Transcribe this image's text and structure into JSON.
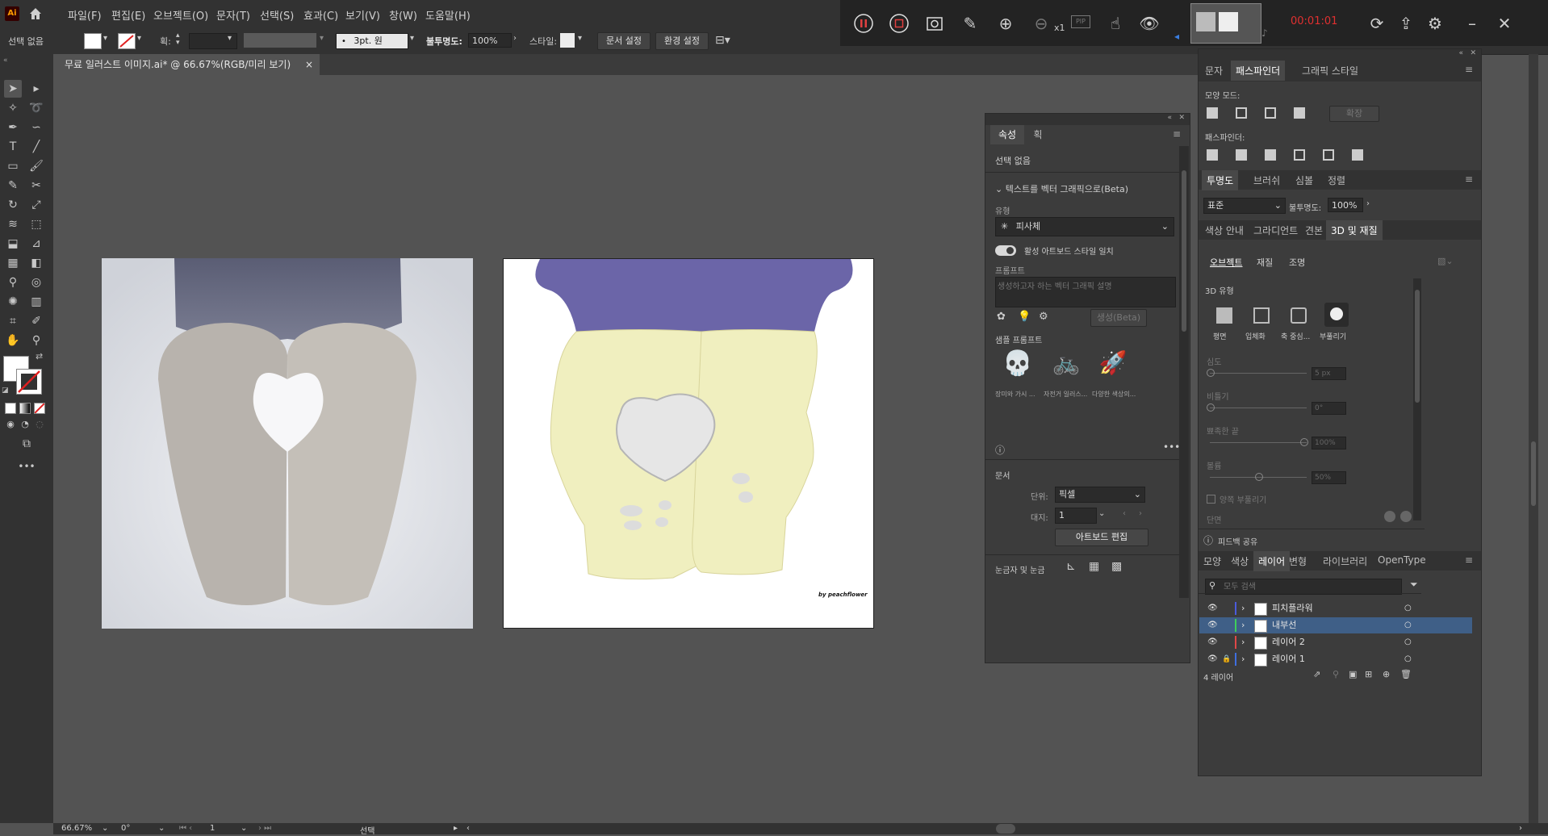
{
  "app": {
    "logo": "Ai"
  },
  "menu": [
    "파일(F)",
    "편집(E)",
    "오브젝트(O)",
    "문자(T)",
    "선택(S)",
    "효과(C)",
    "보기(V)",
    "창(W)",
    "도움말(H)"
  ],
  "control_bar": {
    "selection": "선택 없음",
    "stroke_label": "획:",
    "brush": "3pt. 원",
    "opacity_label": "불투명도:",
    "opacity_value": "100%",
    "style_label": "스타일:",
    "doc_setup": "문서 설정",
    "preferences": "환경 설정"
  },
  "recorder": {
    "speed": "x1",
    "pip": "PIP",
    "timer": "00:01:01"
  },
  "document_tab": {
    "title": "무료 일러스트 이미지.ai* @ 66.67%(RGB/미리 보기)",
    "close": "×"
  },
  "status_bar": {
    "zoom": "66.67%",
    "rotation": "0°",
    "artboard": "1",
    "tool": "선택"
  },
  "properties_panel": {
    "tabs": [
      "속성",
      "획"
    ],
    "no_selection": "선택 없음",
    "text_to_vector": "텍스트를 벡터 그래픽으로(Beta)",
    "type_label": "유형",
    "type_value": "피사체",
    "toggle_label": "활성 아트보드 스타일 일치",
    "prompt_label": "프롬프트",
    "prompt_placeholder": "생성하고자 하는 벡터 그래픽 설명",
    "generate": "생성(Beta)",
    "sample_label": "샘플 프롬프트",
    "samples": [
      "장미와 가시 ...",
      "자전거 일러스...",
      "다양한 색상의..."
    ],
    "document_label": "문서",
    "units_label": "단위:",
    "units_value": "픽셀",
    "artboard_label": "대지:",
    "artboard_value": "1",
    "edit_artboards": "아트보드 편집",
    "rulers_label": "눈금자 및 눈금"
  },
  "pathfinder_panel": {
    "tabs": [
      "문자",
      "패스파인더",
      "그래픽 스타일"
    ],
    "shape_modes": "모양 모드:",
    "expand": "확장",
    "pathfinders": "패스파인더:"
  },
  "transparency_panel": {
    "tabs": [
      "투명도",
      "브러쉬",
      "심볼",
      "정렬"
    ],
    "blend": "표준",
    "opacity_label": "불투명도:",
    "opacity_value": "100%"
  },
  "materials_panel": {
    "tabs": [
      "색상 안내",
      "그라디언트",
      "견본",
      "3D 및 재질"
    ],
    "subtabs": [
      "오브젝트",
      "재질",
      "조명"
    ],
    "type_label": "3D 유형",
    "types": [
      "평면",
      "입체화",
      "축 중심...",
      "부풀리기"
    ],
    "params": [
      {
        "label": "심도",
        "value": "5 px"
      },
      {
        "label": "비틀기",
        "value": "0°"
      },
      {
        "label": "뾰족한 끝",
        "value": "100%"
      },
      {
        "label": "볼륨",
        "value": "50%"
      }
    ],
    "both_sides": "양쪽 부풀리기",
    "bevel": "단면",
    "feedback": "피드백 공유"
  },
  "layers_panel": {
    "tabs": [
      "모양",
      "색상",
      "레이어",
      "변형",
      "라이브러리",
      "OpenType"
    ],
    "search_placeholder": "모두 검색",
    "layers": [
      {
        "name": "피치플라워",
        "color": "#4b5bdc",
        "locked": false,
        "selected": false
      },
      {
        "name": "내부선",
        "color": "#3ecf5a",
        "locked": false,
        "selected": true
      },
      {
        "name": "레이어 2",
        "color": "#e04848",
        "locked": false,
        "selected": false
      },
      {
        "name": "레이어 1",
        "color": "#3f6fe0",
        "locked": true,
        "selected": false
      }
    ],
    "count": "4 레이어"
  },
  "artwork": {
    "signature": "by peachflower"
  },
  "colors": {
    "mitten": "#f0efbf",
    "sleeve": "#6b65a8",
    "heart": "#e6e6e6"
  }
}
